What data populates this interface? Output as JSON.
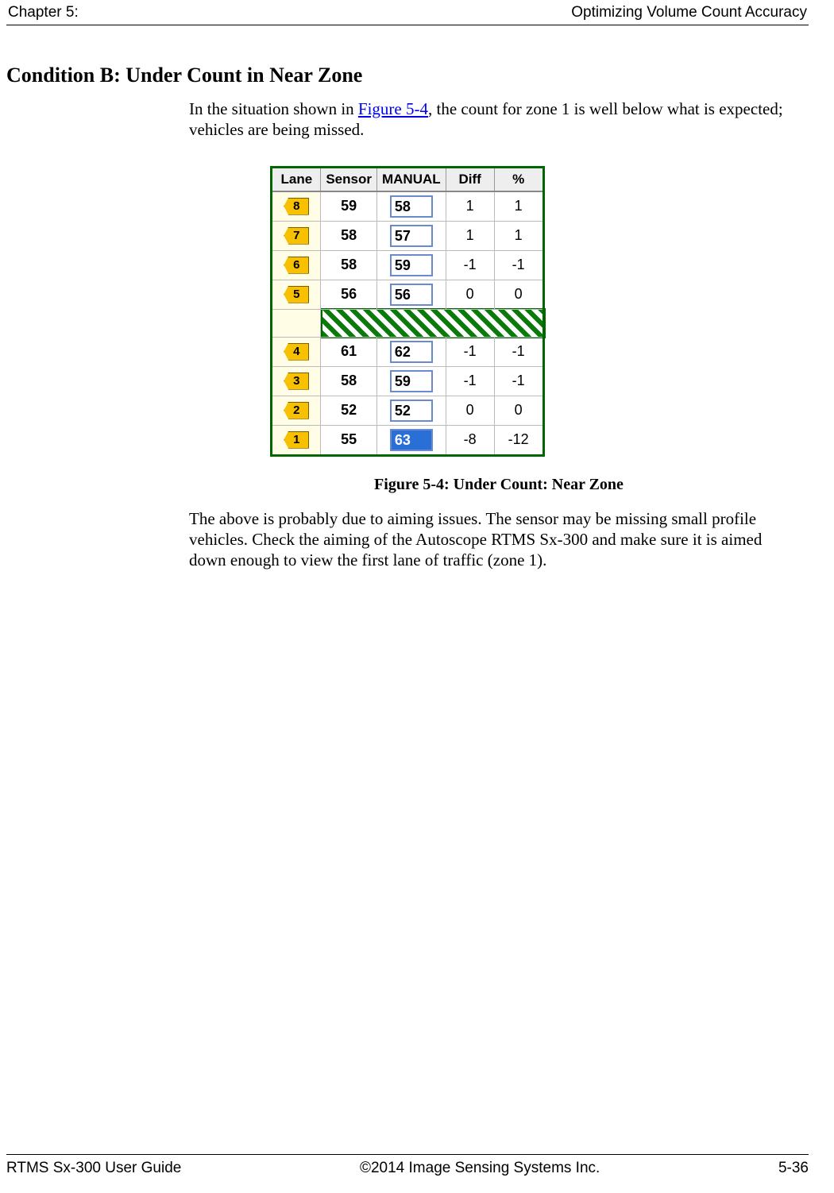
{
  "header": {
    "left": "Chapter 5:",
    "right": "Optimizing Volume Count Accuracy"
  },
  "section_title": "Condition B: Under Count in Near Zone",
  "intro": {
    "pre_link": "In the situation shown in ",
    "link_text": "Figure 5-4",
    "post_link": ", the count for zone 1 is well below what is expected; vehicles are being missed."
  },
  "chart_data": {
    "type": "table",
    "headers": [
      "Lane",
      "Sensor",
      "MANUAL",
      "Diff",
      "%"
    ],
    "rows": [
      {
        "lane": "8",
        "sensor": 59,
        "manual": 58,
        "diff": 1,
        "pct": 1,
        "selected": false
      },
      {
        "lane": "7",
        "sensor": 58,
        "manual": 57,
        "diff": 1,
        "pct": 1,
        "selected": false
      },
      {
        "lane": "6",
        "sensor": 58,
        "manual": 59,
        "diff": -1,
        "pct": -1,
        "selected": false
      },
      {
        "lane": "5",
        "sensor": 56,
        "manual": 56,
        "diff": 0,
        "pct": 0,
        "selected": false
      },
      {
        "median": true
      },
      {
        "lane": "4",
        "sensor": 61,
        "manual": 62,
        "diff": -1,
        "pct": -1,
        "selected": false
      },
      {
        "lane": "3",
        "sensor": 58,
        "manual": 59,
        "diff": -1,
        "pct": -1,
        "selected": false
      },
      {
        "lane": "2",
        "sensor": 52,
        "manual": 52,
        "diff": 0,
        "pct": 0,
        "selected": false
      },
      {
        "lane": "1",
        "sensor": 55,
        "manual": 63,
        "diff": -8,
        "pct": -12,
        "selected": true
      }
    ]
  },
  "figure_caption": "Figure 5-4: Under Count: Near Zone",
  "body2": "The above is probably due to aiming issues. The sensor may be missing small profile vehicles. Check the aiming of the Autoscope RTMS Sx-300 and make sure it is aimed down enough to view the first lane of traffic (zone 1).",
  "footer": {
    "left": "RTMS Sx-300 User Guide",
    "center": "©2014 Image Sensing Systems Inc.",
    "right": "5-36"
  }
}
